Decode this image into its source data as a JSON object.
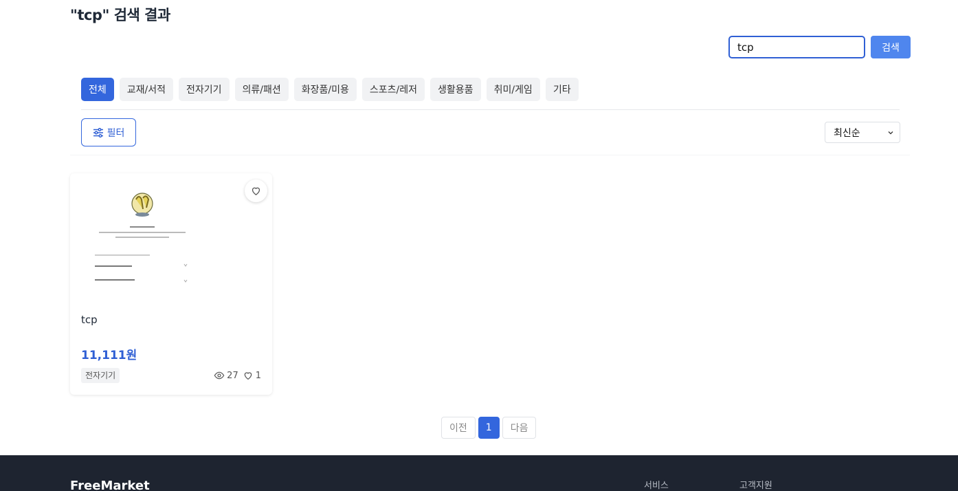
{
  "page": {
    "title": "\"tcp\" 검색 결과"
  },
  "search": {
    "value": "tcp",
    "button_label": "검색"
  },
  "categories": [
    "전체",
    "교재/서적",
    "전자기기",
    "의류/패션",
    "화장품/미용",
    "스포츠/레저",
    "생활용품",
    "취미/게임",
    "기타"
  ],
  "active_category": "전체",
  "filter": {
    "label": "필터",
    "icon": "sliders-icon"
  },
  "sort": {
    "selected": "최신순"
  },
  "products": [
    {
      "name": "tcp",
      "price": "11,111원",
      "category": "전자기기",
      "views": "27",
      "likes": "1"
    }
  ],
  "pagination": {
    "prev": "이전",
    "current": "1",
    "next": "다음"
  },
  "footer": {
    "brand": "FreeMarket",
    "col_service": "서비스",
    "col_support": "고객지원"
  },
  "colors": {
    "accent": "#3366dd",
    "footer_bg": "#1e2430",
    "price": "#2f5fd4"
  }
}
